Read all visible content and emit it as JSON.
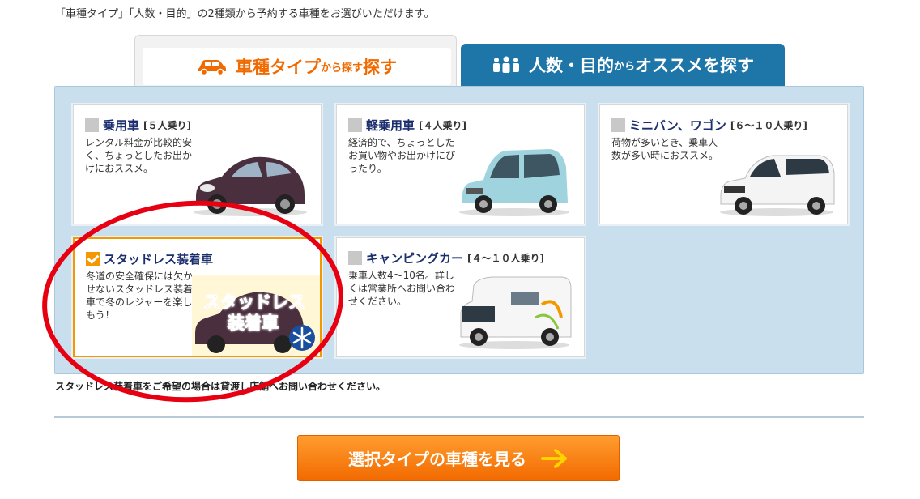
{
  "intro_text": "「車種タイプ」「人数・目的」の2種類から予約する車種をお選びいただけます。",
  "tabs": [
    {
      "label_main": "車種タイプ",
      "label_sub": "から探す",
      "icon": "car-icon"
    },
    {
      "label_main": "人数・目的",
      "label_sub": "からオススメを探す",
      "icon": "people-icon"
    }
  ],
  "cards": [
    {
      "name": "乗用車",
      "capacity": "[５人乗り]",
      "desc": "レンタル料金が比較的安く、ちょっとしたお出かけにおススメ。",
      "checked": false
    },
    {
      "name": "軽乗用車",
      "capacity": "[４人乗り]",
      "desc": "経済的で、ちょっとしたお買い物やお出かけにぴったり。",
      "checked": false
    },
    {
      "name": "ミニバン、ワゴン",
      "capacity": "[６～１０人乗り]",
      "desc": "荷物が多いとき、乗車人数が多い時におススメ。",
      "checked": false
    },
    {
      "name": "スタッドレス装着車",
      "capacity": "",
      "desc": "冬道の安全確保には欠かせないスタッドレス装着車で冬のレジャーを楽しもう！",
      "checked": true,
      "badge": [
        "スタッドレス",
        "装着車"
      ]
    },
    {
      "name": "キャンピングカー",
      "capacity": "[４～１０人乗り]",
      "desc": "乗車人数4～10名。詳しくは営業所へお問い合わせください。",
      "checked": false
    }
  ],
  "note": "スタッドレス装着車をご希望の場合は貸渡し店舗へお問い合わせください。",
  "cta_label": "選択タイプの車種を見る",
  "colors": {
    "accent": "#f39800",
    "tab_blue": "#1d75a8",
    "panel": "#c9dfee",
    "title_navy": "#1b2e6e",
    "annotation_red": "#e60012"
  }
}
